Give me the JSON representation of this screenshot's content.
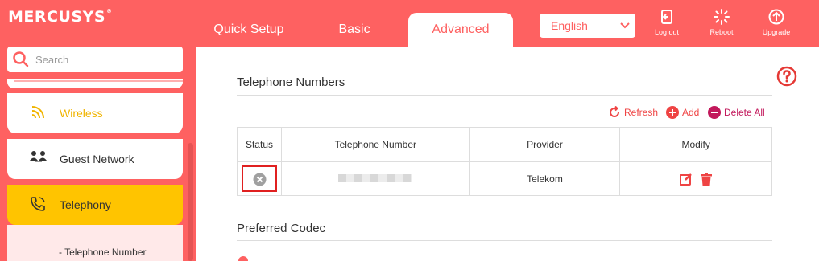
{
  "header": {
    "logo_text": "MERCUSYS",
    "tabs": [
      {
        "label": "Quick Setup"
      },
      {
        "label": "Basic"
      },
      {
        "label": "Advanced"
      }
    ],
    "language": "English",
    "buttons": {
      "logout": "Log out",
      "reboot": "Reboot",
      "upgrade": "Upgrade"
    }
  },
  "sidebar": {
    "search_placeholder": "Search",
    "items": [
      {
        "label": "Wireless"
      },
      {
        "label": "Guest Network"
      },
      {
        "label": "Telephony"
      }
    ],
    "subitem": "- Telephone Number"
  },
  "main": {
    "section1_title": "Telephone Numbers",
    "actions": {
      "refresh": "Refresh",
      "add": "Add",
      "delete_all": "Delete All"
    },
    "table": {
      "headers": [
        "Status",
        "Telephone Number",
        "Provider",
        "Modify"
      ],
      "rows": [
        {
          "provider": "Telekom"
        }
      ]
    },
    "section2_title": "Preferred Codec"
  },
  "colors": {
    "brand": "#fe6161",
    "active_item": "#ffc400",
    "action": "#ef4444"
  }
}
